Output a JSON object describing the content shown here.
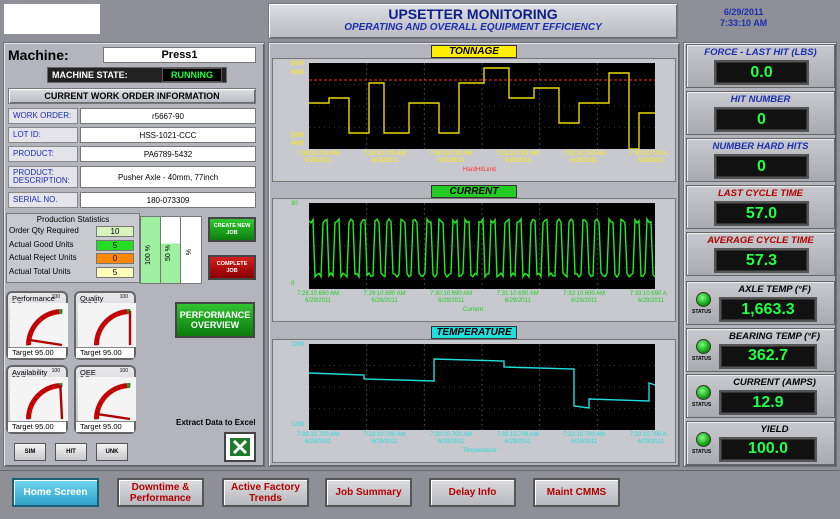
{
  "header": {
    "title": "UPSETTER MONITORING",
    "subtitle": "OPERATING AND OVERALL EQUIPMENT EFFICIENCY",
    "date": "6/29/2011",
    "time": "7:33:10 AM"
  },
  "machine": {
    "label": "Machine:",
    "value": "Press1",
    "state_label": "MACHINE STATE:",
    "state_value": "RUNNING"
  },
  "work_order": {
    "section_title": "CURRENT WORK ORDER INFORMATION",
    "fields": [
      {
        "label": "WORK ORDER:",
        "value": "r5667-90"
      },
      {
        "label": "LOT ID:",
        "value": "HSS-1021-CCC"
      },
      {
        "label": "PRODUCT:",
        "value": "PA6789-5432"
      },
      {
        "label": "PRODUCT: DESCRIPTION:",
        "value": "Pusher Axle - 40mm, 77inch"
      },
      {
        "label": "SERIAL NO.",
        "value": "180-073309"
      }
    ]
  },
  "production": {
    "title": "Production Statistics",
    "rows": [
      {
        "label": "Order Qty Required",
        "value": "10",
        "color": "#d8f5c0"
      },
      {
        "label": "Actual Good Units",
        "value": "5",
        "color": "#22dd22"
      },
      {
        "label": "Actual Reject Units",
        "value": "0",
        "color": "#ff8800"
      },
      {
        "label": "Actual Total Units",
        "value": "5",
        "color": "#ffffbb"
      }
    ],
    "bars": [
      {
        "label": "100 %"
      },
      {
        "label": "50 %"
      },
      {
        "label": "%"
      }
    ],
    "create_job": "CREATE NEW JOB",
    "complete_job": "COMPLETE JOB",
    "perf_overview": "PERFORMANCE OVERVIEW"
  },
  "gauges": [
    {
      "name": "Performance",
      "value": "9.8",
      "target": "Target  95.00"
    },
    {
      "name": "Quality",
      "value": "100.0",
      "target": "Target  95.00"
    },
    {
      "name": "Availability",
      "value": "96.8",
      "target": "Target  95.00"
    },
    {
      "name": "OEE",
      "value": "9.5",
      "target": "Target  95.00"
    }
  ],
  "gauge_scale": {
    "min": "0",
    "max": "100"
  },
  "small_buttons": [
    "SIM",
    "HIT",
    "UNK"
  ],
  "extract": {
    "label": "Extract Data to Excel"
  },
  "charts": {
    "tonnage": {
      "title": "TONNAGE",
      "y_top": "8000",
      "y_top2": "6000",
      "y_bottom": "4000",
      "y_bottom2": "2000",
      "legend": "HardHitLimit",
      "ticks": [
        {
          "t": "7:28:10.720 AM",
          "d": "6/29/2011"
        },
        {
          "t": "7:29:10.720 AM",
          "d": "6/29/2011"
        },
        {
          "t": "7:30:10.720 AM",
          "d": "6/29/2011"
        },
        {
          "t": "7:31:10.720 AM",
          "d": "6/29/2011"
        },
        {
          "t": "7:32:10.720 AM",
          "d": "6/29/2011"
        },
        {
          "t": "7:33:10.720 A",
          "d": "6/29/2011"
        }
      ]
    },
    "current": {
      "title": "CURRENT",
      "y_top": "30",
      "y_bottom": "0",
      "legend": "Current",
      "ticks": [
        {
          "t": "7:28:10.690 AM",
          "d": "6/29/2011"
        },
        {
          "t": "7:29:10.690 AM",
          "d": "6/29/2011"
        },
        {
          "t": "7:30:10.690 AM",
          "d": "6/29/2011"
        },
        {
          "t": "7:31:10.690 AM",
          "d": "6/29/2011"
        },
        {
          "t": "7:32:10.690 AM",
          "d": "6/29/2011"
        },
        {
          "t": "7:33:10.690 A",
          "d": "6/29/2011"
        }
      ]
    },
    "temperature": {
      "title": "TEMPERATURE",
      "y_top": "2200",
      "y_bottom": "1200",
      "legend": "Temperature",
      "ticks": [
        {
          "t": "7:28:10.700 AM",
          "d": "6/29/2011"
        },
        {
          "t": "7:29:10.700 AM",
          "d": "6/29/2011"
        },
        {
          "t": "7:30:10.700 AM",
          "d": "6/29/2011"
        },
        {
          "t": "7:31:10.700 AM",
          "d": "6/29/2011"
        },
        {
          "t": "7:32:10.700 AM",
          "d": "6/29/2011"
        },
        {
          "t": "7:33:10.700 A",
          "d": "6/29/2011"
        }
      ]
    }
  },
  "metrics": [
    {
      "label": "FORCE - LAST HIT (LBS)",
      "value": "0.0",
      "color": "#1a2fb0"
    },
    {
      "label": "HIT NUMBER",
      "value": "0",
      "color": "#1a2fb0"
    },
    {
      "label": "NUMBER HARD HITS",
      "value": "0",
      "color": "#1a2fb0"
    },
    {
      "label": "LAST CYCLE TIME",
      "value": "57.0",
      "color": "#b00000"
    },
    {
      "label": "AVERAGE CYCLE TIME",
      "value": "57.3",
      "color": "#b00000"
    }
  ],
  "status_metrics": [
    {
      "label": "AXLE TEMP (°F)",
      "value": "1,663.3"
    },
    {
      "label": "BEARING TEMP (°F)",
      "value": "362.7"
    },
    {
      "label": "CURRENT (AMPS)",
      "value": "12.9"
    },
    {
      "label": "YIELD",
      "value": "100.0"
    }
  ],
  "status_label": "STATUS",
  "nav": [
    {
      "label": "Home Screen",
      "active": true
    },
    {
      "label": "Downtime & Performance"
    },
    {
      "label": "Active Factory Trends"
    },
    {
      "label": "Job Summary"
    },
    {
      "label": "Delay Info"
    },
    {
      "label": "Maint CMMS"
    }
  ]
}
